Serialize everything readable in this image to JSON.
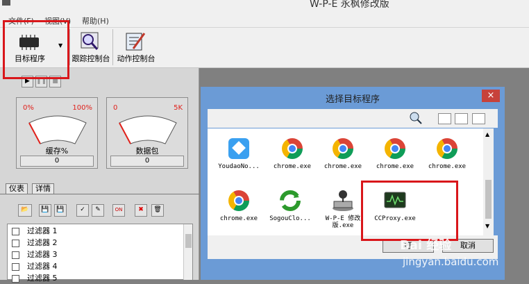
{
  "window": {
    "title": "W-P-E 永枫修改版"
  },
  "menu": [
    "文件(F)",
    "视图(V)",
    "帮助(H)"
  ],
  "toolbar": {
    "target_label": "目标程序",
    "trace_label": "跟踪控制台",
    "action_label": "动作控制台"
  },
  "gauges": [
    {
      "name": "缓存%",
      "min": "0%",
      "max": "100%",
      "value": "0"
    },
    {
      "name": "数据包",
      "min": "0",
      "max": "5K",
      "value": "0"
    }
  ],
  "tabs": [
    "仪表",
    "详情"
  ],
  "filters": [
    "过滤器 1",
    "过滤器 2",
    "过滤器 3",
    "过滤器 4",
    "过滤器 5"
  ],
  "dialog": {
    "title": "选择目标程序",
    "close": "×",
    "items": [
      {
        "label": "YoudaoNo...",
        "icon": "youdao-note-icon"
      },
      {
        "label": "chrome.exe",
        "icon": "chrome-icon"
      },
      {
        "label": "chrome.exe",
        "icon": "chrome-icon"
      },
      {
        "label": "chrome.exe",
        "icon": "chrome-icon"
      },
      {
        "label": "chrome.exe",
        "icon": "chrome-icon"
      },
      {
        "label": "chrome.exe",
        "icon": "chrome-icon"
      },
      {
        "label": "SogouClo...",
        "icon": "sogou-cloud-icon"
      },
      {
        "label": "W-P-E 修改版.exe",
        "icon": "wpe-icon"
      },
      {
        "label": "CCProxy.exe",
        "icon": "ccproxy-icon"
      }
    ],
    "open_label": "打",
    "cancel_label": "取消"
  },
  "watermark": {
    "brand": "Bai 经验",
    "url": "jingyan.baidu.com"
  },
  "colors": {
    "highlight": "#d9161a",
    "dialog_frame": "#6b9bd6",
    "gauge_red": "#e0201a"
  }
}
